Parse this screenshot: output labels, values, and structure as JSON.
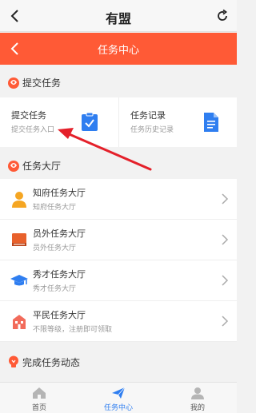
{
  "header": {
    "title": "有盟"
  },
  "subheader": {
    "title": "任务中心"
  },
  "submit_section": {
    "title": "提交任务"
  },
  "cards": [
    {
      "title": "提交任务",
      "subtitle": "提交任务入口",
      "icon": "clipboard-check-icon"
    },
    {
      "title": "任务记录",
      "subtitle": "任务历史记录",
      "icon": "document-icon"
    }
  ],
  "hall_section": {
    "title": "任务大厅"
  },
  "halls": [
    {
      "title": "知府任务大厅",
      "subtitle": "知府任务大厅",
      "icon": "person-icon"
    },
    {
      "title": "员外任务大厅",
      "subtitle": "员外任务大厅",
      "icon": "book-icon"
    },
    {
      "title": "秀才任务大厅",
      "subtitle": "秀才任务大厅",
      "icon": "graduation-cap-icon"
    },
    {
      "title": "平民任务大厅",
      "subtitle": "不限等级，注册即可领取",
      "icon": "building-icon"
    }
  ],
  "dynamic_section": {
    "title": "完成任务动态"
  },
  "tabs": [
    {
      "label": "首页",
      "icon": "home-icon",
      "active": false
    },
    {
      "label": "任务中心",
      "icon": "send-icon",
      "active": true
    },
    {
      "label": "我的",
      "icon": "user-icon",
      "active": false
    }
  ],
  "colors": {
    "accent": "#ff5a36",
    "active_tab": "#2f7ef0",
    "card_icon": "#2f7ef0"
  }
}
